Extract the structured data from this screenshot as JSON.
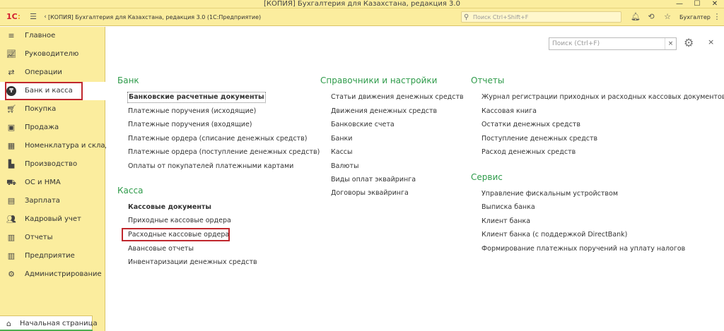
{
  "window": {
    "title": "[КОПИЯ] Бухгалтерия для Казахстана, редакция 3.0",
    "controls": {
      "minimize": "—",
      "maximize": "☐",
      "close": "✕"
    }
  },
  "appbar": {
    "logo_text": "1С",
    "title": "[КОПИЯ] Бухгалтерия для Казахстана, редакция 3.0  (1С:Предприятие)",
    "search_placeholder": "Поиск Ctrl+Shift+F",
    "user": "Бухгалтер",
    "icons": [
      "menu-icon",
      "back-icon",
      "forward-icon",
      "bell-icon",
      "history-icon",
      "star-icon",
      "kebab-icon",
      "minimize-icon",
      "maximize-icon",
      "close-icon"
    ]
  },
  "sidebar": {
    "items": [
      {
        "label": "Главное",
        "icon": "hamburger-icon"
      },
      {
        "label": "Руководителю",
        "icon": "chart-icon"
      },
      {
        "label": "Операции",
        "icon": "operations-icon"
      },
      {
        "label": "Банк и касса",
        "icon": "tenge-icon",
        "active": true
      },
      {
        "label": "Покупка",
        "icon": "cart-icon"
      },
      {
        "label": "Продажа",
        "icon": "bag-icon"
      },
      {
        "label": "Номенклатура и склад",
        "icon": "grid-icon"
      },
      {
        "label": "Производство",
        "icon": "factory-icon"
      },
      {
        "label": "ОС и НМА",
        "icon": "truck-icon"
      },
      {
        "label": "Зарплата",
        "icon": "salary-icon"
      },
      {
        "label": "Кадровый учет",
        "icon": "people-icon"
      },
      {
        "label": "Отчеты",
        "icon": "bar-chart-icon"
      },
      {
        "label": "Предприятие",
        "icon": "enterprise-icon"
      },
      {
        "label": "Администрирование",
        "icon": "gear-icon"
      }
    ],
    "home_tab": "Начальная страница"
  },
  "main": {
    "search_placeholder": "Поиск (Ctrl+F)",
    "search_clear": "×",
    "close": "×",
    "bank": {
      "title": "Банк",
      "links": [
        "Банковские расчетные документы",
        "Платежные поручения (исходящие)",
        "Платежные поручения (входящие)",
        "Платежные ордера (списание денежных средств)",
        "Платежные ордера (поступление денежных средств)",
        "Оплаты от покупателей платежными картами"
      ]
    },
    "kassa": {
      "title": "Касса",
      "links": [
        "Кассовые документы",
        "Приходные кассовые ордера",
        "Расходные кассовые ордера",
        "Авансовые отчеты",
        "Инвентаризации денежных средств"
      ]
    },
    "refs": {
      "title": "Справочники и настройки",
      "links": [
        "Статьи движения денежных средств",
        "Движения денежных средств",
        "Банковские счета",
        "Банки",
        "Кассы",
        "Валюты",
        "Виды оплат эквайринга",
        "Договоры эквайринга"
      ]
    },
    "reports": {
      "title": "Отчеты",
      "links": [
        "Журнал регистрации приходных и расходных кассовых документов",
        "Кассовая книга",
        "Остатки денежных средств",
        "Поступление денежных средств",
        "Расход денежных средств"
      ]
    },
    "service": {
      "title": "Сервис",
      "links": [
        "Управление фискальным устройством",
        "Выписка банка",
        "Клиент банка",
        "Клиент банка (с поддержкой DirectBank)",
        "Формирование платежных поручений на уплату налогов"
      ]
    }
  }
}
